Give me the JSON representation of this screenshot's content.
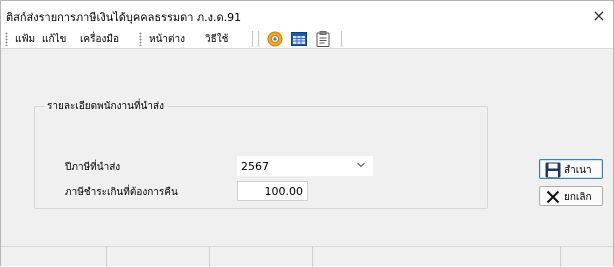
{
  "window": {
    "title": "ติสก์ส่งรายการภาษีเงินได้บุคคลธรรมดา ภ.ง.ด.91",
    "close_glyph": "×"
  },
  "menu": {
    "items": [
      "แฟ้ม",
      "แก้ไข",
      "เครื่องมือ",
      "หน้าต่าง",
      "วิธีใช้"
    ]
  },
  "toolbar": {
    "icons": [
      "help-lifebuoy-icon",
      "calculator-window-icon",
      "clipboard-icon"
    ]
  },
  "form": {
    "group_label": "รายละเอียดพนักงานที่นำส่ง",
    "tax_year_label": "ปีภาษีที่นำส่ง",
    "tax_year_value": "2567",
    "refund_label": "ภาษีชำระเกินที่ต้องการคืน",
    "refund_value": "100.00"
  },
  "buttons": {
    "save_label": "สำเนา",
    "cancel_label": "ยกเลิก"
  },
  "colors": {
    "accent": "#3c7fb1",
    "save_icon": "#1f3a5a",
    "help_icon": "#f5a623",
    "calc_icon": "#1e5aa8"
  }
}
